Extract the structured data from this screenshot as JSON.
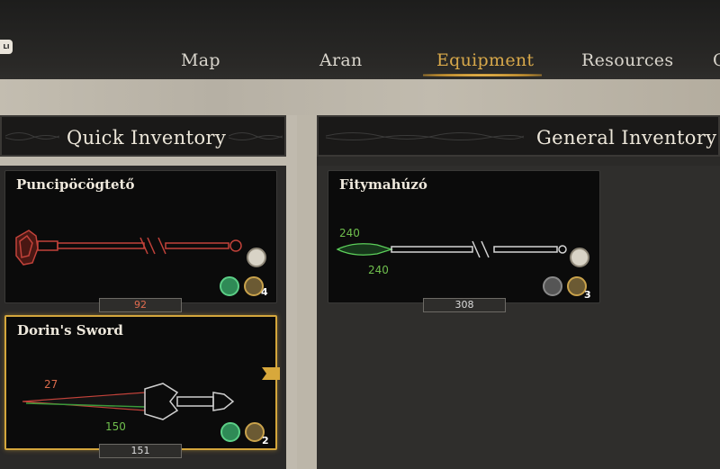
{
  "nav": {
    "key_hint": "LI",
    "tabs": [
      "Map",
      "Aran",
      "Equipment",
      "Resources",
      "C"
    ],
    "active_tab": "Equipment"
  },
  "panels": {
    "quick_inventory": {
      "title": "Quick Inventory"
    },
    "general_inventory": {
      "title": "General Inventory"
    }
  },
  "items": [
    {
      "name": "Puncipöcögtető",
      "price": "92",
      "badge_count": "4"
    },
    {
      "name": "Dorin's Sword",
      "top_value": "27",
      "bottom_value": "150",
      "price": "151",
      "badge_count": "2"
    },
    {
      "name": "Fitymahúzó",
      "top_value": "240",
      "bottom_value": "240",
      "price": "308",
      "badge_count": "3"
    }
  ],
  "colors": {
    "accent": "#d8a84a",
    "damage_red": "#d96a4b",
    "stat_green": "#6fbf4d"
  }
}
